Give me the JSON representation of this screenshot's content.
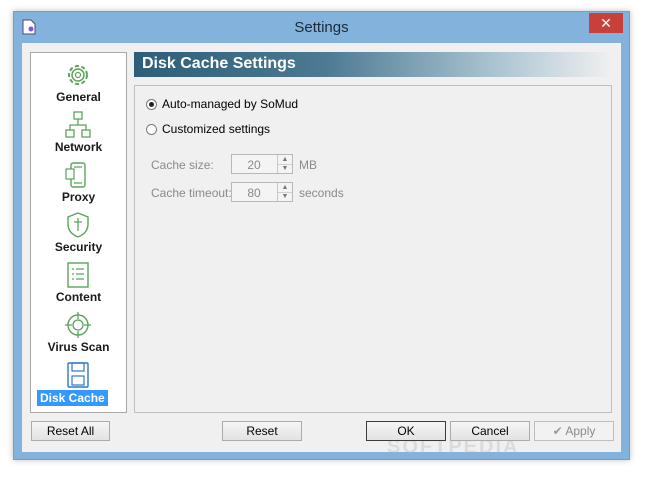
{
  "window": {
    "title": "Settings",
    "close_symbol": "✕"
  },
  "sidebar": {
    "items": [
      {
        "label": "General",
        "icon": "gear-icon"
      },
      {
        "label": "Network",
        "icon": "network-icon"
      },
      {
        "label": "Proxy",
        "icon": "proxy-icon"
      },
      {
        "label": "Security",
        "icon": "shield-icon"
      },
      {
        "label": "Content",
        "icon": "list-icon"
      },
      {
        "label": "Virus Scan",
        "icon": "target-icon"
      },
      {
        "label": "Disk Cache",
        "icon": "floppy-disk-icon",
        "selected": true
      }
    ]
  },
  "panel": {
    "title": "Disk Cache Settings",
    "options": [
      {
        "label": "Auto-managed by SoMud",
        "checked": true
      },
      {
        "label": "Customized settings",
        "checked": false
      }
    ],
    "fields": [
      {
        "label": "Cache size:",
        "value": "20",
        "unit": "MB"
      },
      {
        "label": "Cache timeout:",
        "value": "80",
        "unit": "seconds"
      }
    ]
  },
  "buttons": {
    "reset_all": "Reset All",
    "reset": "Reset",
    "ok": "OK",
    "cancel": "Cancel",
    "apply": "Apply"
  },
  "watermark": "SOFTPEDIA",
  "colors": {
    "accent": "#3399ff",
    "header_dark": "#2d5d78",
    "frame": "#83b3dc",
    "close": "#c7413a"
  }
}
